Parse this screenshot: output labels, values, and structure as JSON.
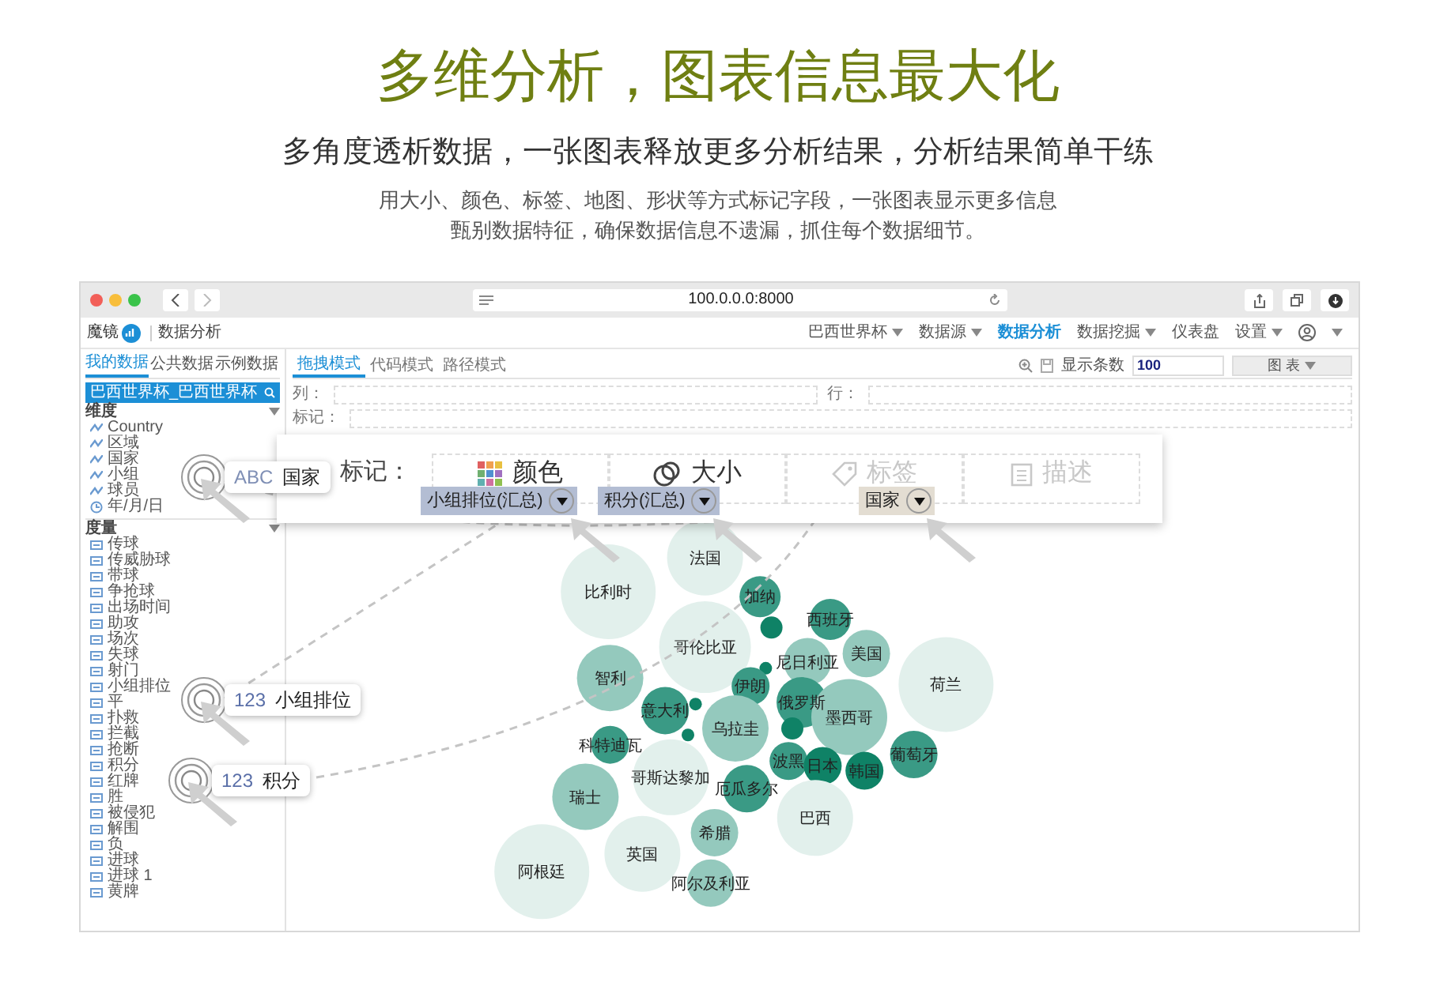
{
  "heading": "多维分析，图表信息最大化",
  "subheading": "多角度透析数据，一张图表释放更多分析结果，分析结果简单干练",
  "description": [
    "用大小、颜色、标签、地图、形状等方式标记字段，一张图表显示更多信息",
    "甄别数据特征，确保数据信息不遗漏，抓住每个数据细节。"
  ],
  "browser": {
    "url": "100.0.0.0:8000"
  },
  "app": {
    "logo": "魔镜",
    "section": "数据分析",
    "nav": [
      {
        "label": "巴西世界杯",
        "selected": false,
        "dropdown": true
      },
      {
        "label": "数据源",
        "selected": false,
        "dropdown": true
      },
      {
        "label": "数据分析",
        "selected": true,
        "dropdown": false
      },
      {
        "label": "数据挖掘",
        "selected": false,
        "dropdown": true
      },
      {
        "label": "仪表盘",
        "selected": false,
        "dropdown": false
      },
      {
        "label": "设置",
        "selected": false,
        "dropdown": true
      }
    ]
  },
  "sidebar": {
    "tabs": [
      {
        "label": "我的数据",
        "selected": true
      },
      {
        "label": "公共数据",
        "selected": false
      },
      {
        "label": "示例数据",
        "selected": false
      }
    ],
    "dataset": "巴西世界杯_巴西世界杯",
    "groups": [
      {
        "title": "维度",
        "items": [
          {
            "label": "Country",
            "kind": "text"
          },
          {
            "label": "区域",
            "kind": "text"
          },
          {
            "label": "国家",
            "kind": "text"
          },
          {
            "label": "小组",
            "kind": "text"
          },
          {
            "label": "球员",
            "kind": "text"
          },
          {
            "label": "年/月/日",
            "kind": "date"
          }
        ]
      },
      {
        "title": "度量",
        "items": [
          {
            "label": "传球",
            "kind": "measure"
          },
          {
            "label": "传威胁球",
            "kind": "measure"
          },
          {
            "label": "带球",
            "kind": "measure"
          },
          {
            "label": "争抢球",
            "kind": "measure"
          },
          {
            "label": "出场时间",
            "kind": "measure"
          },
          {
            "label": "助攻",
            "kind": "measure"
          },
          {
            "label": "场次",
            "kind": "measure"
          },
          {
            "label": "失球",
            "kind": "measure"
          },
          {
            "label": "射门",
            "kind": "measure"
          },
          {
            "label": "小组排位",
            "kind": "measure"
          },
          {
            "label": "平",
            "kind": "measure"
          },
          {
            "label": "扑救",
            "kind": "measure"
          },
          {
            "label": "拦截",
            "kind": "measure"
          },
          {
            "label": "抢断",
            "kind": "measure"
          },
          {
            "label": "积分",
            "kind": "measure"
          },
          {
            "label": "红牌",
            "kind": "measure"
          },
          {
            "label": "胜",
            "kind": "measure"
          },
          {
            "label": "被侵犯",
            "kind": "measure"
          },
          {
            "label": "解围",
            "kind": "measure"
          },
          {
            "label": "负",
            "kind": "measure"
          },
          {
            "label": "进球",
            "kind": "measure"
          },
          {
            "label": "进球 1",
            "kind": "measure"
          },
          {
            "label": "黄牌",
            "kind": "measure"
          }
        ]
      }
    ]
  },
  "main": {
    "tabs": [
      {
        "label": "拖拽模式",
        "selected": true
      },
      {
        "label": "代码模式",
        "selected": false
      },
      {
        "label": "路径模式",
        "selected": false
      }
    ],
    "rows_label": "显示条数",
    "rows_value": "100",
    "chart_button": "图 表",
    "columns_label": "列：",
    "rows_shelf_label": "行：",
    "marks_label": "标记："
  },
  "marks_panel": {
    "title": "标记：",
    "channels": [
      {
        "label": "颜色",
        "kind": "color",
        "disabled": false,
        "pill": "小组排位(汇总)",
        "color": "#b3bdd3"
      },
      {
        "label": "大小",
        "kind": "size",
        "disabled": false,
        "pill": "积分(汇总)",
        "color": "#b3bdd3"
      },
      {
        "label": "标签",
        "kind": "label",
        "disabled": true,
        "pill": "国家",
        "color": "#e3ddd2"
      },
      {
        "label": "描述",
        "kind": "detail",
        "disabled": true
      }
    ]
  },
  "callouts": [
    {
      "type": "ABC",
      "name": "国家"
    },
    {
      "type": "123",
      "name": "小组排位"
    },
    {
      "type": "123",
      "name": "积分"
    }
  ],
  "bubbles": [
    {
      "label": "法国",
      "color": "#e2f0ec"
    },
    {
      "label": "比利时",
      "color": "#e2f0ec"
    },
    {
      "label": "加纳",
      "color": "#3a9a85"
    },
    {
      "color": "#0f8266"
    },
    {
      "label": "西班牙",
      "color": "#3a9a85"
    },
    {
      "label": "哥伦比亚",
      "color": "#e2f0ec"
    },
    {
      "color": "#0f8266"
    },
    {
      "label": "尼日利亚",
      "color": "#94c9bd"
    },
    {
      "label": "美国",
      "color": "#94c9bd"
    },
    {
      "label": "智利",
      "color": "#94c9bd"
    },
    {
      "color": "#0f8266"
    },
    {
      "label": "伊朗",
      "color": "#3a9a85"
    },
    {
      "label": "俄罗斯",
      "color": "#3a9a85"
    },
    {
      "label": "荷兰",
      "color": "#e2f0ec"
    },
    {
      "label": "意大利",
      "color": "#3a9a85"
    },
    {
      "color": "#0f8266"
    },
    {
      "label": "乌拉圭",
      "color": "#94c9bd"
    },
    {
      "color": "#0f8266"
    },
    {
      "label": "墨西哥",
      "color": "#94c9bd"
    },
    {
      "label": "科特迪瓦",
      "color": "#3a9a85"
    },
    {
      "label": "波黑",
      "color": "#3a9a85"
    },
    {
      "label": "日本",
      "color": "#0f8266"
    },
    {
      "label": "葡萄牙",
      "color": "#3a9a85"
    },
    {
      "label": "瑞士",
      "color": "#94c9bd"
    },
    {
      "label": "哥斯达黎加",
      "color": "#e2f0ec"
    },
    {
      "label": "厄瓜多尔",
      "color": "#3a9a85"
    },
    {
      "label": "韩国",
      "color": "#0f8266"
    },
    {
      "label": "希腊",
      "color": "#94c9bd"
    },
    {
      "label": "巴西",
      "color": "#e2f0ec"
    },
    {
      "label": "英国",
      "color": "#e2f0ec"
    },
    {
      "label": "阿根廷",
      "color": "#e2f0ec"
    },
    {
      "label": "阿尔及利亚",
      "color": "#94c9bd"
    }
  ]
}
